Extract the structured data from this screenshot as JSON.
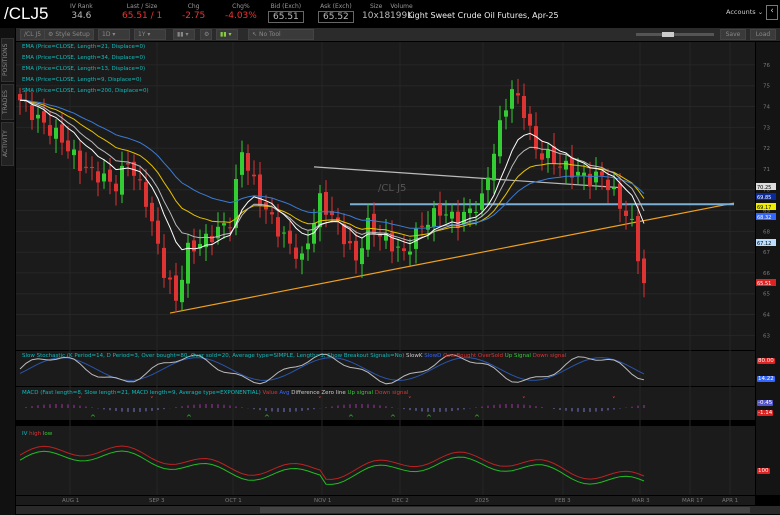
{
  "header": {
    "symbol": "/CLJ5",
    "fields": [
      {
        "label": "IV Rank",
        "value": "34.6"
      },
      {
        "label": "Last / Size",
        "value": "65.51 / 1"
      },
      {
        "label": "Chg",
        "value": "-2.75"
      },
      {
        "label": "Chg%",
        "value": "-4.03%"
      },
      {
        "label": "Bid (Exch)",
        "value": "65.51"
      },
      {
        "label": "Ask (Exch)",
        "value": "65.52"
      },
      {
        "label": "Size",
        "value": "10x18"
      },
      {
        "label": "Volume",
        "value": "199K"
      }
    ],
    "description": "Light Sweet Crude Oil Futures, Apr-25",
    "accounts": "Accounts"
  },
  "toolbar": {
    "symbol": "/CL J5",
    "style": "Style Setup",
    "aggregation": "1D",
    "period": "1Y",
    "drawing": "No Tool",
    "save": "Save",
    "load": "Load"
  },
  "sidebar": [
    "POSITIONS",
    "TRADES",
    "ACTIVITY"
  ],
  "legend": [
    "EMA (Price=CLOSE, Length=21, Displace=0)",
    "EMA (Price=CLOSE, Length=34, Displace=0)",
    "EMA (Price=CLOSE, Length=13, Displace=0)",
    "EMA (Price=CLOSE, Length=9, Displace=0)",
    "SMA (Price=CLOSE, Length=200, Displace=0)"
  ],
  "watermark": "/CL J5",
  "stoch": {
    "label": "Slow Stochastic (K Period=14, D Period=3, Over bought=80, Over sold=20, Average type=SIMPLE, Length=3, Show Breakout Signals=No)",
    "items": [
      "SlowK",
      "SlowD",
      "OverBought",
      "OverSold",
      "Up Signal",
      "Down signal"
    ],
    "tags": [
      "80.00",
      "14.22"
    ]
  },
  "macd": {
    "label": "MACD (Fast length=8, Slow length=21, MACD length=9, Average type=EXPONENTIAL)",
    "items": [
      "Value",
      "Avg",
      "Diff",
      "Difference",
      "Zero line",
      "Up signal",
      "Down signal"
    ],
    "tags": [
      "-0.45",
      "-1.14"
    ]
  },
  "iv": {
    "label": "IV",
    "items": [
      "high",
      "low"
    ],
    "tags": [
      "100"
    ]
  },
  "chart_data": {
    "type": "candlestick",
    "symbol": "/CLJ5",
    "keypoints": [
      [
        0,
        74.3
      ],
      [
        3,
        73.4
      ],
      [
        7,
        72.4
      ],
      [
        10,
        71.2
      ],
      [
        13,
        70.7
      ],
      [
        16,
        70.2
      ],
      [
        18,
        71.4
      ],
      [
        21,
        69.5
      ],
      [
        24,
        66.1
      ],
      [
        26,
        64.7
      ],
      [
        28,
        67.1
      ],
      [
        31,
        67.6
      ],
      [
        35,
        68.5
      ],
      [
        37,
        71.9
      ],
      [
        40,
        69.5
      ],
      [
        43,
        68.1
      ],
      [
        47,
        66.6
      ],
      [
        50,
        69.5
      ],
      [
        53,
        68.3
      ],
      [
        56,
        66.6
      ],
      [
        58,
        68.3
      ],
      [
        61,
        67.6
      ],
      [
        64,
        66.9
      ],
      [
        67,
        68.3
      ],
      [
        70,
        69.0
      ],
      [
        73,
        68.5
      ],
      [
        77,
        69.5
      ],
      [
        79,
        71.9
      ],
      [
        81,
        74.1
      ],
      [
        82,
        74.8
      ],
      [
        84,
        73.8
      ],
      [
        86,
        71.9
      ],
      [
        89,
        71.4
      ],
      [
        92,
        70.9
      ],
      [
        95,
        70.5
      ],
      [
        97,
        70.7
      ],
      [
        100,
        69.3
      ],
      [
        102,
        68.3
      ],
      [
        104,
        65.5
      ]
    ],
    "last": 65.51,
    "price_ticks": [
      76,
      75,
      74,
      73,
      72,
      71,
      70,
      69,
      68,
      67,
      66,
      65,
      64,
      63
    ],
    "price_tags": [
      {
        "v": "70.25",
        "c": "#ddd"
      },
      {
        "v": "69.85",
        "c": "#0a2a9a"
      },
      {
        "v": "69.17",
        "c": "#ee0"
      },
      {
        "v": "68.32",
        "c": "#36f"
      },
      {
        "v": "67.12",
        "c": "#bdf"
      },
      {
        "v": "65.51",
        "c": "#d22"
      }
    ],
    "dates": [
      "AUG 1",
      "SEP 3",
      "OCT 1",
      "NOV 1",
      "DEC 2",
      "2025",
      "FEB 3",
      "MAR 3",
      "MAR 17",
      "APR 1"
    ],
    "trendlines": [
      {
        "name": "support",
        "from": [
          25,
          64.07
        ],
        "to": [
          119,
          69.36
        ],
        "color": "#f0a020"
      },
      {
        "name": "resistance",
        "from": [
          55,
          69.3
        ],
        "to": [
          119,
          69.3
        ],
        "color": "#7ab0d8"
      },
      {
        "name": "descending",
        "from": [
          49,
          71.1
        ],
        "to": [
          100,
          70.1
        ],
        "color": "#bbb"
      }
    ],
    "colors": {
      "up": "#3c3",
      "down": "#d33",
      "ema21": "#e6c200",
      "ema34": "#3a7bd5",
      "ema13": "#bbb",
      "ema9": "#fff",
      "sma200": "#ccc"
    }
  }
}
